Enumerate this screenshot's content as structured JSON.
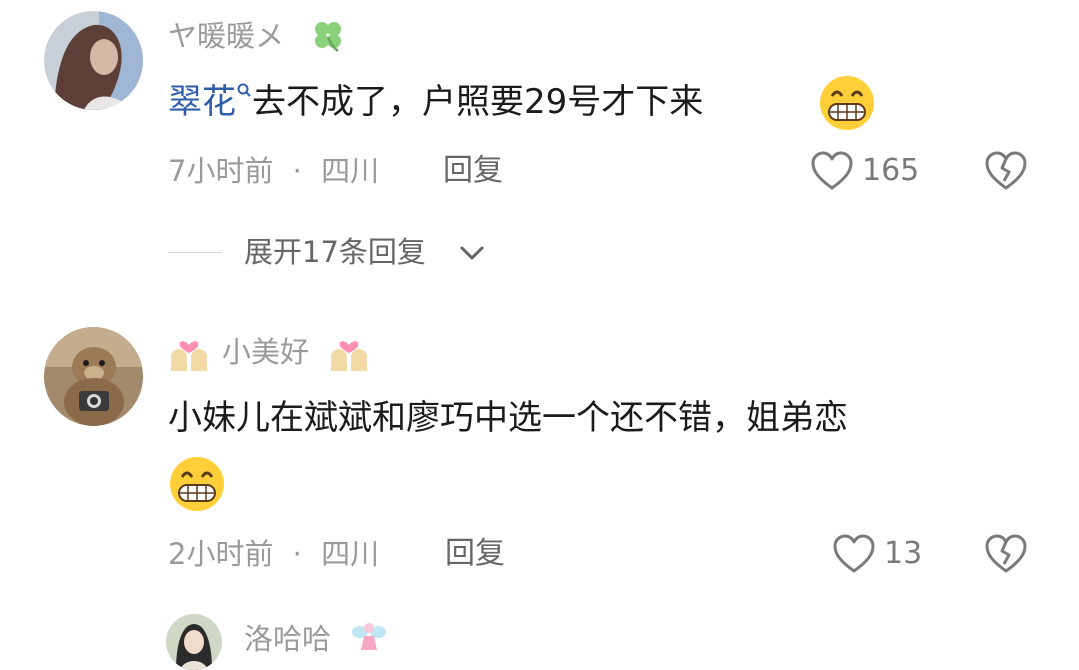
{
  "comments": [
    {
      "username": "ヤ暖暖メ",
      "username_badge_icon": "four-leaf-clover-icon",
      "mention": "翠花",
      "mention_icon": "search-icon",
      "text": "去不成了，户照要29号才下来",
      "emoji": "grinning-face-icon",
      "time": "7小时前",
      "separator": "·",
      "location": "四川",
      "reply_label": "回复",
      "like_count": "165",
      "expand_replies_label": "展开17条回复"
    },
    {
      "username": "小美好",
      "username_badge_icon": "couple-heart-icon",
      "text": "小妹儿在斌斌和廖巧中选一个还不错，姐弟恋",
      "emoji": "grinning-face-icon",
      "time": "2小时前",
      "separator": "·",
      "location": "四川",
      "reply_label": "回复",
      "like_count": "13"
    },
    {
      "username": "洛哈哈",
      "username_badge_icon": "fairy-icon"
    }
  ],
  "colors": {
    "username": "#9b9b9b",
    "mention": "#2f5ea8",
    "text": "#1b1b1b",
    "meta": "#9a9a9a"
  }
}
